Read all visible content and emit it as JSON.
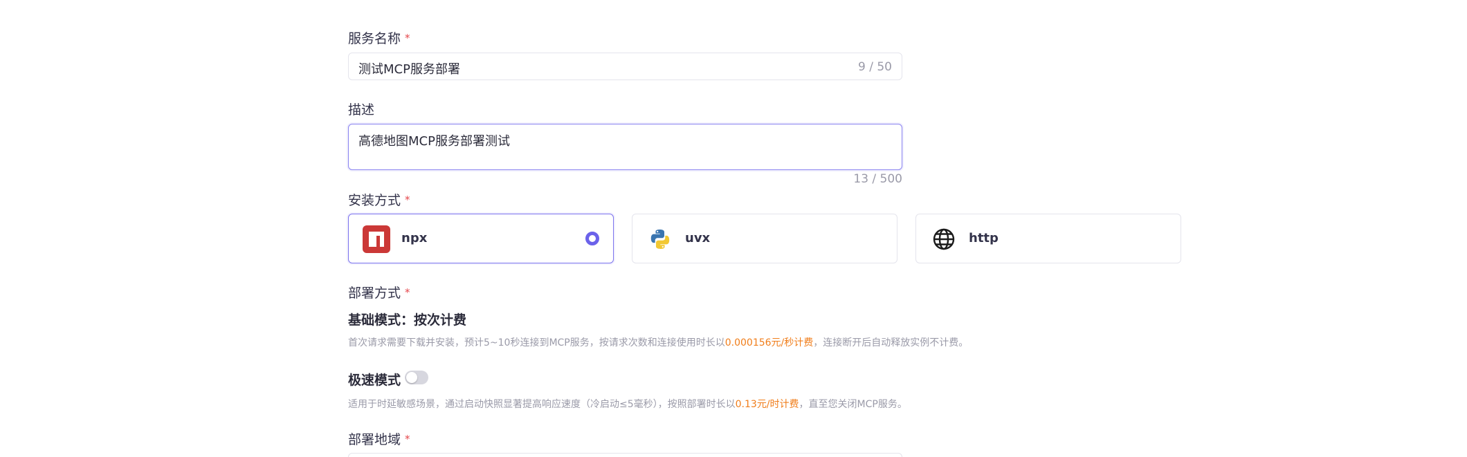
{
  "service_name": {
    "label": "服务名称",
    "required_mark": "*",
    "value": "测试MCP服务部署",
    "counter": "9 / 50"
  },
  "description": {
    "label": "描述",
    "value": "高德地图MCP服务部署测试",
    "counter": "13 / 500"
  },
  "install_method": {
    "label": "安装方式",
    "required_mark": "*",
    "options": [
      {
        "label": "npx",
        "icon": "npm-icon",
        "selected": true
      },
      {
        "label": "uvx",
        "icon": "python-icon",
        "selected": false
      },
      {
        "label": "http",
        "icon": "globe-icon",
        "selected": false
      }
    ]
  },
  "deploy_method": {
    "label": "部署方式",
    "required_mark": "*",
    "basic": {
      "title": "基础模式：按次计费",
      "desc_before": "首次请求需要下载并安装，预计5~10秒连接到MCP服务，按请求次数和连接使用时长以",
      "price": "0.000156元/秒计费",
      "desc_after": "，连接断开后自动释放实例不计费。"
    },
    "fast": {
      "title": "极速模式",
      "enabled": false,
      "desc_before": "适用于时延敏感场景，通过启动快照显著提高响应速度（冷启动≤5毫秒），按照部署时长以",
      "price": "0.13元/时计费",
      "desc_after": "，直至您关闭MCP服务。"
    }
  },
  "deploy_region": {
    "label": "部署地域",
    "required_mark": "*"
  },
  "colors": {
    "accent": "#6b62ea",
    "required": "#e5484d",
    "price": "#f07d1a",
    "muted": "#9a9aa8"
  }
}
